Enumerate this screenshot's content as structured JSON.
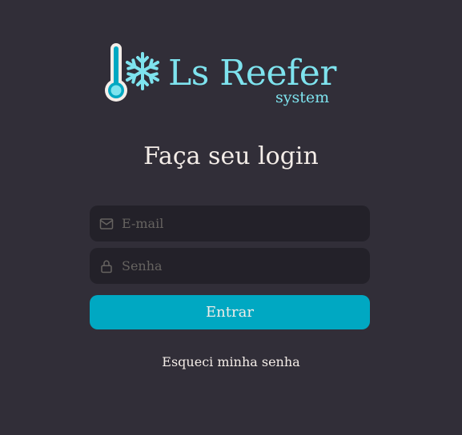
{
  "logo": {
    "title": "Ls Reefer",
    "subtitle": "system",
    "icons": [
      "thermometer-icon",
      "snowflake-icon"
    ]
  },
  "heading": "Faça seu login",
  "form": {
    "email_placeholder": "E-mail",
    "email_icon": "mail-icon",
    "password_placeholder": "Senha",
    "password_icon": "lock-icon",
    "submit_label": "Entrar"
  },
  "forgot_link": "Esqueci minha senha",
  "colors": {
    "background": "#312e38",
    "input_background": "#232129",
    "accent": "#00a8c2",
    "logo": "#7ee3ee",
    "text": "#f4ede8",
    "placeholder": "#666360"
  }
}
